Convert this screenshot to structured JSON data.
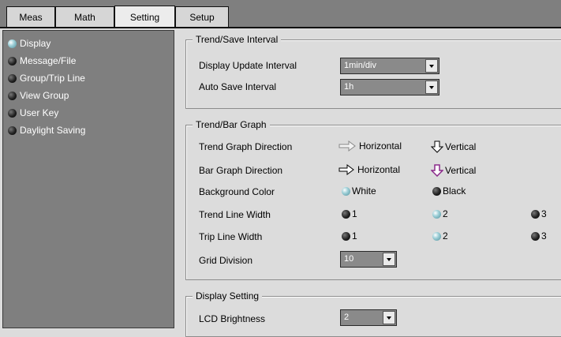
{
  "tabs": [
    {
      "label": "Meas"
    },
    {
      "label": "Math"
    },
    {
      "label": "Setting"
    },
    {
      "label": "Setup"
    }
  ],
  "active_tab": "Setting",
  "sidebar": {
    "items": [
      {
        "label": "Display",
        "selected": true
      },
      {
        "label": "Message/File",
        "selected": false
      },
      {
        "label": "Group/Trip Line",
        "selected": false
      },
      {
        "label": "View Group",
        "selected": false
      },
      {
        "label": "User Key",
        "selected": false
      },
      {
        "label": "Daylight Saving",
        "selected": false
      }
    ]
  },
  "trend_save": {
    "title": "Trend/Save Interval",
    "display_update_label": "Display Update Interval",
    "display_update_value": "1min/div",
    "auto_save_label": "Auto Save Interval",
    "auto_save_value": "1h"
  },
  "trend_bar": {
    "title": "Trend/Bar Graph",
    "trend_dir_label": "Trend Graph Direction",
    "trend_dir_horizontal": "Horizontal",
    "trend_dir_vertical": "Vertical",
    "bar_dir_label": "Bar Graph Direction",
    "bar_dir_horizontal": "Horizontal",
    "bar_dir_vertical": "Vertical",
    "bg_color_label": "Background Color",
    "bg_white": "White",
    "bg_black": "Black",
    "trend_width_label": "Trend Line Width",
    "trend_width_1": "1",
    "trend_width_2": "2",
    "trend_width_3": "3",
    "trip_width_label": "Trip Line Width",
    "trip_width_1": "1",
    "trip_width_2": "2",
    "trip_width_3": "3",
    "grid_div_label": "Grid Division",
    "grid_div_value": "10"
  },
  "display_setting": {
    "title": "Display Setting",
    "lcd_label": "LCD Brightness",
    "lcd_value": "2"
  },
  "colors": {
    "selected_radio": "#9fd0d8",
    "panel": "#7f7f7f",
    "background": "#dcdcdc"
  }
}
